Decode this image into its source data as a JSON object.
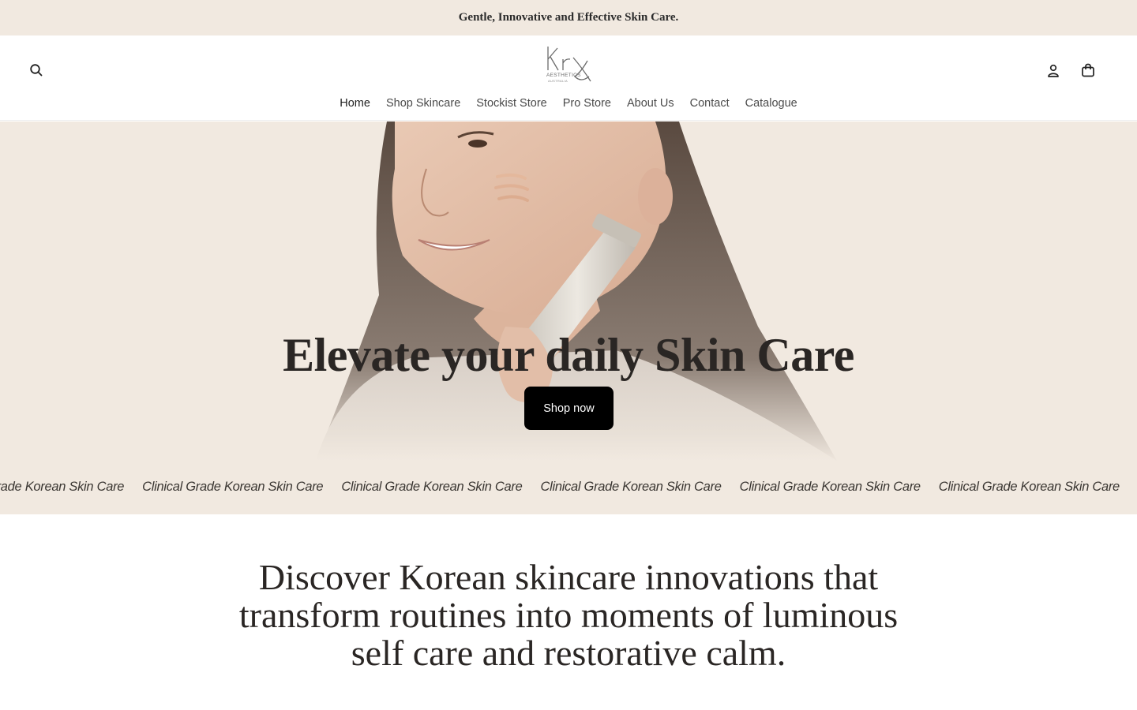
{
  "announcement": {
    "text": "Gentle, Innovative and Effective Skin Care."
  },
  "header": {
    "logo": {
      "wordmark": "Krx",
      "sub": "AESTHETICS",
      "region": "AUSTRALIA"
    },
    "icons": {
      "search": "search-icon",
      "account": "user-icon",
      "cart": "shopping-bag-icon"
    }
  },
  "nav": {
    "items": [
      {
        "label": "Home"
      },
      {
        "label": "Shop Skincare"
      },
      {
        "label": "Stockist Store"
      },
      {
        "label": "Pro Store"
      },
      {
        "label": "About Us"
      },
      {
        "label": "Contact"
      },
      {
        "label": "Catalogue"
      }
    ]
  },
  "hero": {
    "title": "Elevate your daily Skin Care",
    "button": "Shop now"
  },
  "marquee": {
    "items": [
      "Clinical Grade Korean Skin Care",
      "Clinical Grade Korean Skin Care",
      "Clinical Grade Korean Skin Care",
      "Clinical Grade Korean Skin Care",
      "Clinical Grade Korean Skin Care",
      "Clinical Grade Korean Skin Care"
    ]
  },
  "intro": {
    "text": "Discover Korean skincare innovations that transform routines into moments of luminous self care and restorative calm."
  },
  "colors": {
    "cream": "#f1e9e0",
    "button": "#000000",
    "text": "#2a2624"
  }
}
